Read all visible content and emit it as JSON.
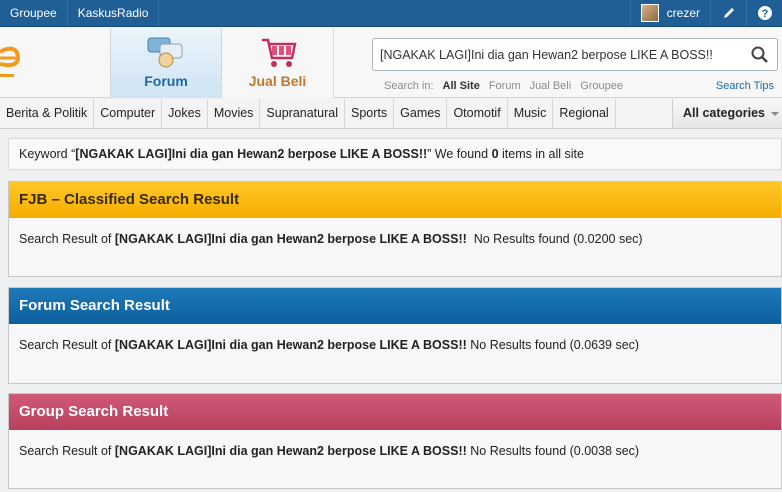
{
  "topbar": {
    "links": [
      "Groupee",
      "KaskusRadio"
    ],
    "username": "crezer"
  },
  "header": {
    "tabs": [
      {
        "label": "Forum",
        "icon": "forum-icon"
      },
      {
        "label": "Jual Beli",
        "icon": "cart-icon"
      }
    ],
    "search": {
      "value": "[NGAKAK LAGI]Ini dia gan Hewan2 berpose LIKE A BOSS!!",
      "search_in_label": "Search in:",
      "scopes": [
        "All Site",
        "Forum",
        "Jual Beli",
        "Groupee"
      ],
      "active_scope": "All Site",
      "tips": "Search Tips"
    }
  },
  "categories": [
    "Berita & Politik",
    "Computer",
    "Jokes",
    "Movies",
    "Supranatural",
    "Sports",
    "Games",
    "Otomotif",
    "Music",
    "Regional"
  ],
  "all_categories": "All categories",
  "keyword_line": {
    "prefix": "Keyword “",
    "keyword": "[NGAKAK LAGI]Ini dia gan Hewan2 berpose LIKE A BOSS!!",
    "middle": "” We found ",
    "count": "0",
    "suffix": " items in all site"
  },
  "panels": [
    {
      "title": "FJB – Classified Search Result",
      "prefix": "Search Result of ",
      "keyword": "[NGAKAK LAGI]Ini dia gan Hewan2 berpose LIKE A BOSS!!",
      "result": "  No Results found (0.0200 sec)"
    },
    {
      "title": "Forum Search Result",
      "prefix": "Search Result of ",
      "keyword": "[NGAKAK LAGI]Ini dia gan Hewan2 berpose LIKE A BOSS!!",
      "result": " No Results found (0.0639 sec)"
    },
    {
      "title": "Group Search Result",
      "prefix": "Search Result of ",
      "keyword": "[NGAKAK LAGI]Ini dia gan Hewan2 berpose LIKE A BOSS!!",
      "result": " No Results found (0.0038 sec)"
    }
  ],
  "colors": {
    "topbar": "#1f5f95",
    "fjb": "#f6ad00",
    "forum": "#0d5f9c",
    "group": "#b8405e"
  }
}
